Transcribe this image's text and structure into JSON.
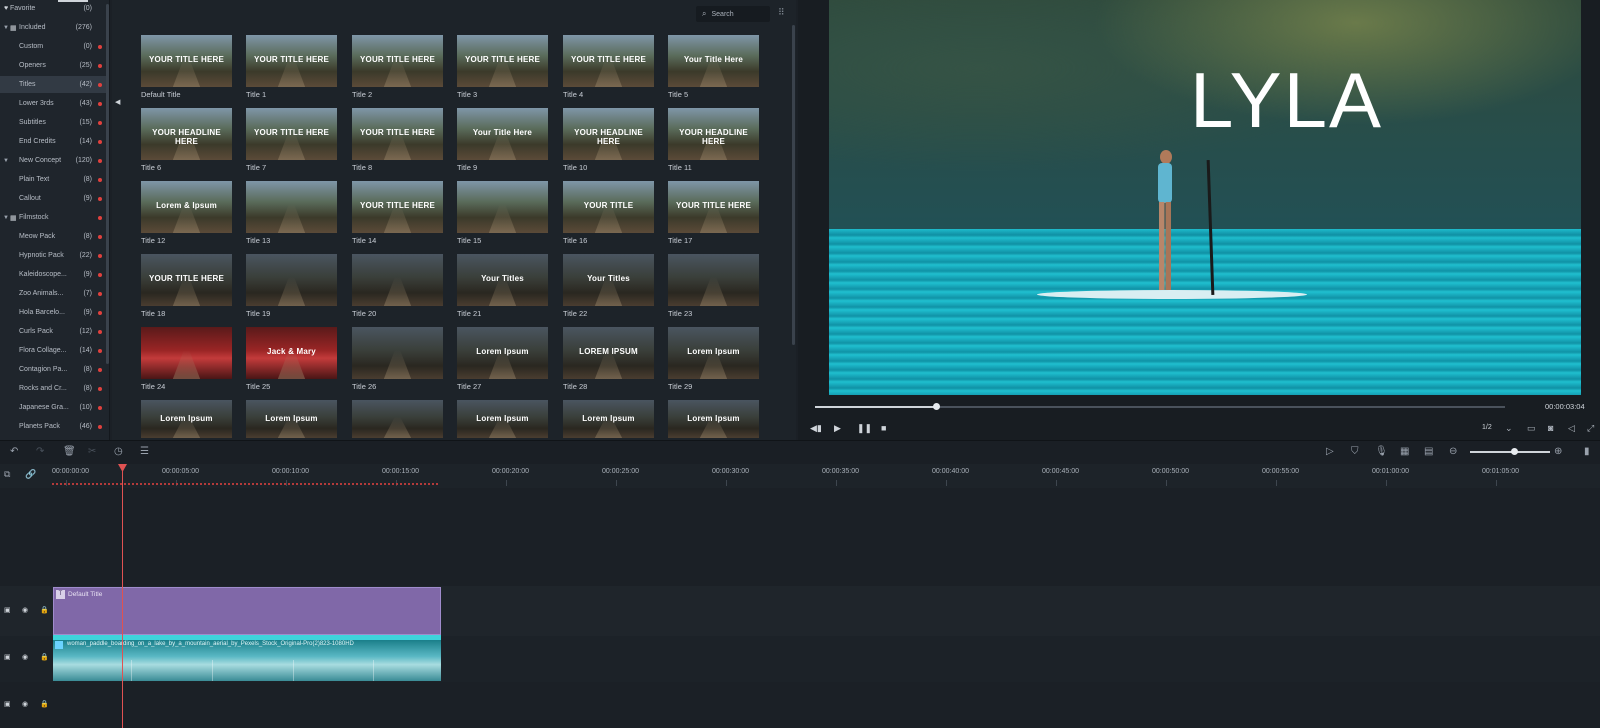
{
  "sidebar": {
    "items": [
      {
        "label": "Favorite",
        "count": "(0)",
        "icon": "heart-icon"
      },
      {
        "label": "Included",
        "count": "(276)",
        "icon": "grid-icon",
        "expandable": true
      },
      {
        "label": "Custom",
        "count": "(0)"
      },
      {
        "label": "Openers",
        "count": "(25)"
      },
      {
        "label": "Titles",
        "count": "(42)",
        "active": true
      },
      {
        "label": "Lower 3rds",
        "count": "(43)"
      },
      {
        "label": "Subtitles",
        "count": "(15)"
      },
      {
        "label": "End Credits",
        "count": "(14)"
      },
      {
        "label": "New Concept",
        "count": "(120)",
        "expandable": true
      },
      {
        "label": "Plain Text",
        "count": "(8)"
      },
      {
        "label": "Callout",
        "count": "(9)"
      },
      {
        "label": "Filmstock",
        "count": "",
        "icon": "grid-icon",
        "expandable": true
      },
      {
        "label": "Meow Pack",
        "count": "(8)"
      },
      {
        "label": "Hypnotic Pack",
        "count": "(22)"
      },
      {
        "label": "Kaleidoscope...",
        "count": "(9)"
      },
      {
        "label": "Zoo Animals...",
        "count": "(7)"
      },
      {
        "label": "Hola Barcelo...",
        "count": "(9)"
      },
      {
        "label": "Curls Pack",
        "count": "(12)"
      },
      {
        "label": "Flora Collage...",
        "count": "(14)"
      },
      {
        "label": "Contagion Pa...",
        "count": "(8)"
      },
      {
        "label": "Rocks and Cr...",
        "count": "(8)"
      },
      {
        "label": "Japanese Gra...",
        "count": "(10)"
      },
      {
        "label": "Planets Pack",
        "count": "(46)"
      }
    ]
  },
  "library": {
    "search_placeholder": "Search",
    "tiles": [
      {
        "label": "Default Title",
        "caption": "YOUR TITLE HERE"
      },
      {
        "label": "Title 1",
        "caption": "YOUR TITLE HERE"
      },
      {
        "label": "Title 2",
        "caption": "YOUR TITLE HERE"
      },
      {
        "label": "Title 3",
        "caption": "YOUR TITLE HERE"
      },
      {
        "label": "Title 4",
        "caption": "YOUR TITLE HERE"
      },
      {
        "label": "Title 5",
        "caption": "Your Title Here"
      },
      {
        "label": "Title 6",
        "caption": "YOUR HEADLINE HERE"
      },
      {
        "label": "Title 7",
        "caption": "YOUR TITLE HERE"
      },
      {
        "label": "Title 8",
        "caption": "YOUR TITLE HERE"
      },
      {
        "label": "Title 9",
        "caption": "Your Title Here"
      },
      {
        "label": "Title 10",
        "caption": "YOUR HEADLINE HERE"
      },
      {
        "label": "Title 11",
        "caption": "YOUR HEADLINE HERE"
      },
      {
        "label": "Title 12",
        "caption": "Lorem & Ipsum"
      },
      {
        "label": "Title 13",
        "caption": ""
      },
      {
        "label": "Title 14",
        "caption": "YOUR TITLE HERE"
      },
      {
        "label": "Title 15",
        "caption": ""
      },
      {
        "label": "Title 16",
        "caption": "YOUR TITLE"
      },
      {
        "label": "Title 17",
        "caption": "YOUR TITLE HERE"
      },
      {
        "label": "Title 18",
        "caption": "YOUR TITLE HERE"
      },
      {
        "label": "Title 19",
        "caption": ""
      },
      {
        "label": "Title 20",
        "caption": ""
      },
      {
        "label": "Title 21",
        "caption": "Your Titles"
      },
      {
        "label": "Title 22",
        "caption": "Your Titles"
      },
      {
        "label": "Title 23",
        "caption": ""
      },
      {
        "label": "Title 24",
        "caption": ""
      },
      {
        "label": "Title 25",
        "caption": "Jack & Mary"
      },
      {
        "label": "Title 26",
        "caption": ""
      },
      {
        "label": "Title 27",
        "caption": "Lorem Ipsum"
      },
      {
        "label": "Title 28",
        "caption": "LOREM IPSUM"
      },
      {
        "label": "Title 29",
        "caption": "Lorem Ipsum"
      },
      {
        "label": "",
        "caption": "Lorem Ipsum"
      },
      {
        "label": "",
        "caption": "Lorem Ipsum"
      },
      {
        "label": "",
        "caption": ""
      },
      {
        "label": "",
        "caption": "Lorem Ipsum"
      },
      {
        "label": "",
        "caption": "Lorem Ipsum"
      },
      {
        "label": "",
        "caption": "Lorem Ipsum"
      }
    ]
  },
  "preview": {
    "overlay_title": "LYLA",
    "timecode": "00:00:03:04",
    "progress": 0.175,
    "ratio": "1/2"
  },
  "timeline": {
    "ruler": [
      "00:00:00:00",
      "00:00:05:00",
      "00:00:10:00",
      "00:00:15:00",
      "00:00:20:00",
      "00:00:25:00",
      "00:00:30:00",
      "00:00:35:00",
      "00:00:40:00",
      "00:00:45:00",
      "00:00:50:00",
      "00:00:55:00",
      "00:01:00:00",
      "00:01:05:00"
    ],
    "title_clip_label": "Default Title",
    "video_clip_label": "woman_paddle_boarding_on_a_lake_by_a_mountain_aerial_by_Pexels_Stock_Original-Pro(2)823-1080HD",
    "zoom_level": 0.55
  },
  "colors": {
    "accent_red": "#e05252",
    "title_clip": "#8068a8",
    "video_clip_bar": "#3fd4dc"
  }
}
